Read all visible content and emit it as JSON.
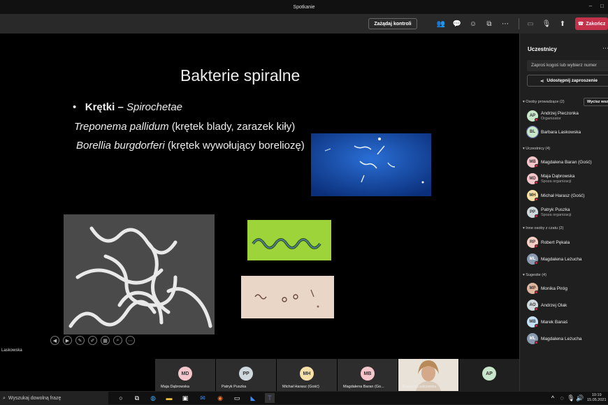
{
  "window": {
    "title": "Spotkanie"
  },
  "toolbar": {
    "request_control": "Zażądaj kontroli",
    "end": "Zakończ"
  },
  "slide": {
    "title": "Bakterie spiralne",
    "bullet_bold": "Krętki –",
    "bullet_italic": "Spirochetae",
    "line2_italic": "Treponema pallidum",
    "line2_rest": "(krętek blady, zarazek kiły)",
    "line3_italic": "Borellia burgdorferi",
    "line3_rest": "(krętek wywołujący boreliozę)",
    "presenter": "Laskowska"
  },
  "panel": {
    "title": "Uczestnicy",
    "invite_placeholder": "Zaproś kogoś lub wybierz numer",
    "share": "Udostępnij zaproszenie",
    "mute_all": "Wycisz wszystkich",
    "sections": {
      "presenters": "Osoby prowadzące (2)",
      "attendees": "Uczestnicy (4)",
      "chat": "Inne osoby z czatu (2)",
      "suggestions": "Sugestie (4)"
    },
    "people": [
      {
        "initials": "AP",
        "name": "Andrzej Pieczonka",
        "sub": "Organizator"
      },
      {
        "initials": "BL",
        "name": "Barbara Laskowska",
        "sub": ""
      },
      {
        "initials": "MB",
        "name": "Magdalena Baran (Gość)",
        "sub": ""
      },
      {
        "initials": "MD",
        "name": "Maja Dąbrowska",
        "sub": "Spoza organizacji"
      },
      {
        "initials": "MH",
        "name": "Michał Harasz (Gość)",
        "sub": ""
      },
      {
        "initials": "PP",
        "name": "Patryk Puszka",
        "sub": "Spoza organizacji"
      },
      {
        "initials": "RP",
        "name": "Robert Pękala",
        "sub": ""
      },
      {
        "initials": "ML",
        "name": "Magdalena Leżucha",
        "sub": ""
      },
      {
        "initials": "MP",
        "name": "Monika Piróg",
        "sub": ""
      },
      {
        "initials": "AO",
        "name": "Andrzej Olak",
        "sub": ""
      },
      {
        "initials": "MB",
        "name": "Marek Banaś",
        "sub": ""
      },
      {
        "initials": "ML",
        "name": "Magdalena Leżucha",
        "sub": ""
      }
    ]
  },
  "gallery": [
    {
      "initials": "MD",
      "name": "Maja Dąbrowska"
    },
    {
      "initials": "PP",
      "name": "Patryk Puszka"
    },
    {
      "initials": "MH",
      "name": "Michał Harasz (Gość)"
    },
    {
      "initials": "MB",
      "name": "Magdalena Baran (Go..."
    },
    {
      "initials": "",
      "name": "Barbara Laskowska"
    },
    {
      "initials": "AP",
      "name": ""
    }
  ],
  "taskbar": {
    "search": "Wyszukaj dowolną frazę",
    "time": "10:19",
    "date": "15.05.2021"
  },
  "colors": {
    "end_button": "#c4314b",
    "accent": "#6264a7"
  }
}
